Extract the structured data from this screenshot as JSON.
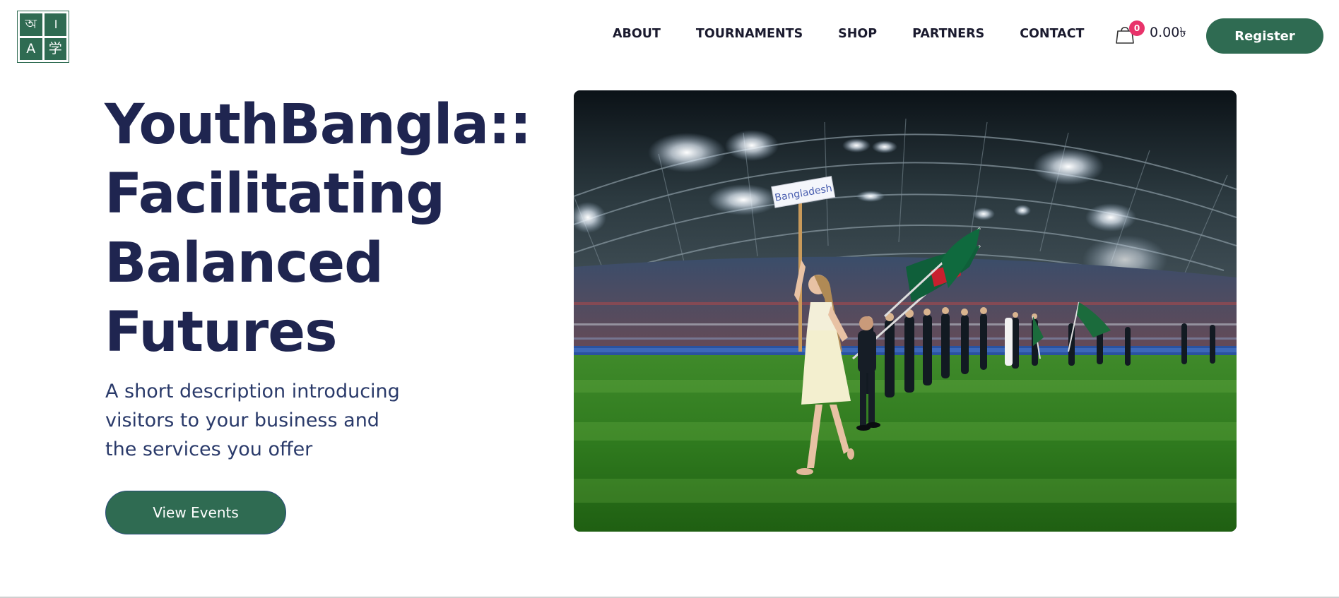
{
  "brand": {
    "logo_glyphs": [
      "অ",
      "।",
      "A",
      "学"
    ]
  },
  "nav": {
    "items": [
      {
        "label": "ABOUT"
      },
      {
        "label": "TOURNAMENTS"
      },
      {
        "label": "SHOP"
      },
      {
        "label": "PARTNERS"
      },
      {
        "label": "CONTACT"
      }
    ]
  },
  "cart": {
    "count": "0",
    "total": "0.00৳",
    "icon": "shopping-bag-icon"
  },
  "header": {
    "register_label": "Register"
  },
  "hero": {
    "title_lines": [
      "YouthBangla::",
      "Facilitating",
      "Balanced",
      "Futures"
    ],
    "description": "A short description introducing visitors to your business and the services you offer",
    "cta_label": "View Events",
    "image": {
      "sign_text": "Bangladesh"
    }
  },
  "colors": {
    "brand_green": "#2f6b52",
    "title_navy": "#1f2550",
    "badge_pink": "#e8336a"
  }
}
